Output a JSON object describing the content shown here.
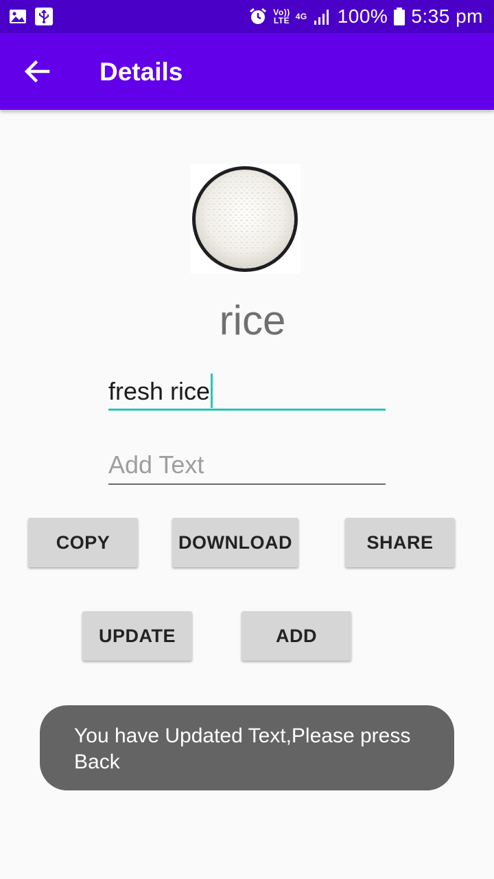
{
  "status_bar": {
    "volte_line1": "Vo))",
    "volte_line2": "LTE",
    "network_type": "4G",
    "battery": "100%",
    "time": "5:35 pm"
  },
  "app_bar": {
    "title": "Details"
  },
  "item": {
    "name": "rice",
    "image_icon": "rice-bowl-image"
  },
  "fields": {
    "description_value": "fresh rice",
    "add_text_placeholder": "Add Text"
  },
  "buttons": {
    "copy": "COPY",
    "download": "DOWNLOAD",
    "share": "SHARE",
    "update": "UPDATE",
    "add": "ADD"
  },
  "toast": {
    "message": "You have Updated Text,Please press Back"
  },
  "colors": {
    "status_bar": "#4b00c8",
    "app_bar": "#6200ea",
    "field_accent": "#22c9b6",
    "button_bg": "#d6d6d6",
    "toast_bg": "#646464"
  }
}
